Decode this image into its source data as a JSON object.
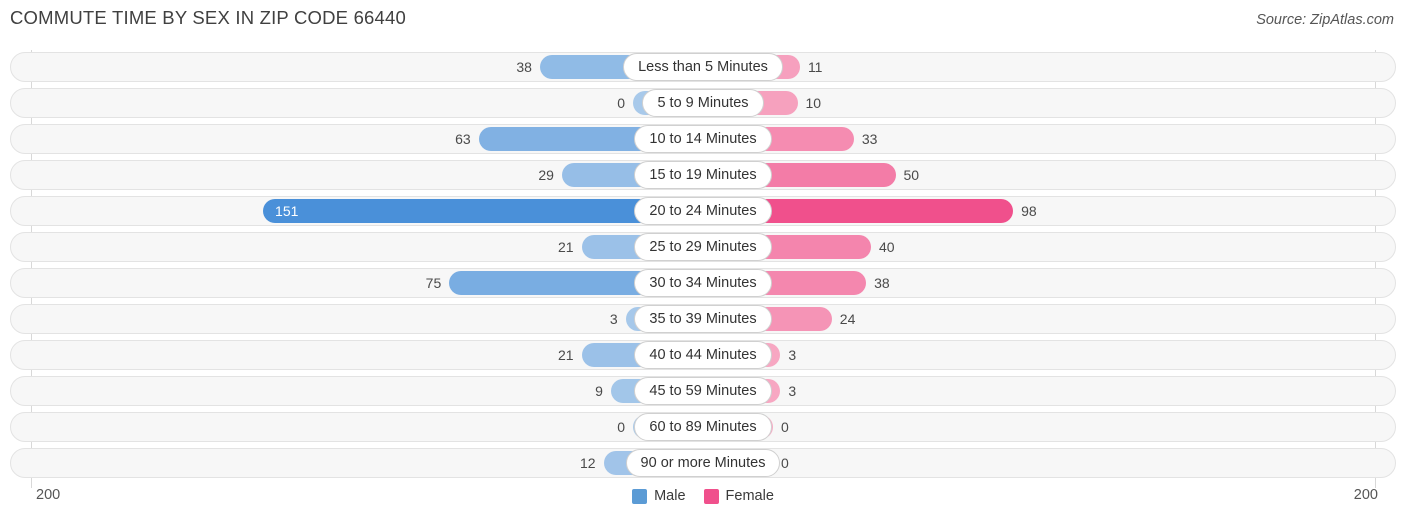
{
  "header": {
    "title": "COMMUTE TIME BY SEX IN ZIP CODE 66440",
    "source": "Source: ZipAtlas.com"
  },
  "axis": {
    "left_label": "200",
    "right_label": "200"
  },
  "legend": {
    "items": [
      {
        "label": "Male",
        "color": "#5b9bd5"
      },
      {
        "label": "Female",
        "color": "#f0508c"
      }
    ]
  },
  "colors": {
    "male_max": "#4a90d9",
    "male_min": "#a8c9ea",
    "female_max": "#f0508c",
    "female_min": "#f7aac4",
    "track_bg": "#f7f7f7",
    "track_border": "#e3e3e3",
    "gridline": "#d8d8d8"
  },
  "chart_data": {
    "type": "bar",
    "subtype": "diverging-butterfly",
    "title": "COMMUTE TIME BY SEX IN ZIP CODE 66440",
    "xlabel": "",
    "ylabel": "",
    "xlim": [
      200,
      200
    ],
    "axis_max": 200,
    "grid": false,
    "legend_position": "bottom-center",
    "categories": [
      "Less than 5 Minutes",
      "5 to 9 Minutes",
      "10 to 14 Minutes",
      "15 to 19 Minutes",
      "20 to 24 Minutes",
      "25 to 29 Minutes",
      "30 to 34 Minutes",
      "35 to 39 Minutes",
      "40 to 44 Minutes",
      "45 to 59 Minutes",
      "60 to 89 Minutes",
      "90 or more Minutes"
    ],
    "series": [
      {
        "name": "Male",
        "direction": "left",
        "color": "#5b9bd5",
        "values": [
          38,
          0,
          63,
          29,
          151,
          21,
          75,
          3,
          21,
          9,
          0,
          12
        ]
      },
      {
        "name": "Female",
        "direction": "right",
        "color": "#f0508c",
        "values": [
          11,
          10,
          33,
          50,
          98,
          40,
          38,
          24,
          3,
          3,
          0,
          0
        ]
      }
    ]
  }
}
